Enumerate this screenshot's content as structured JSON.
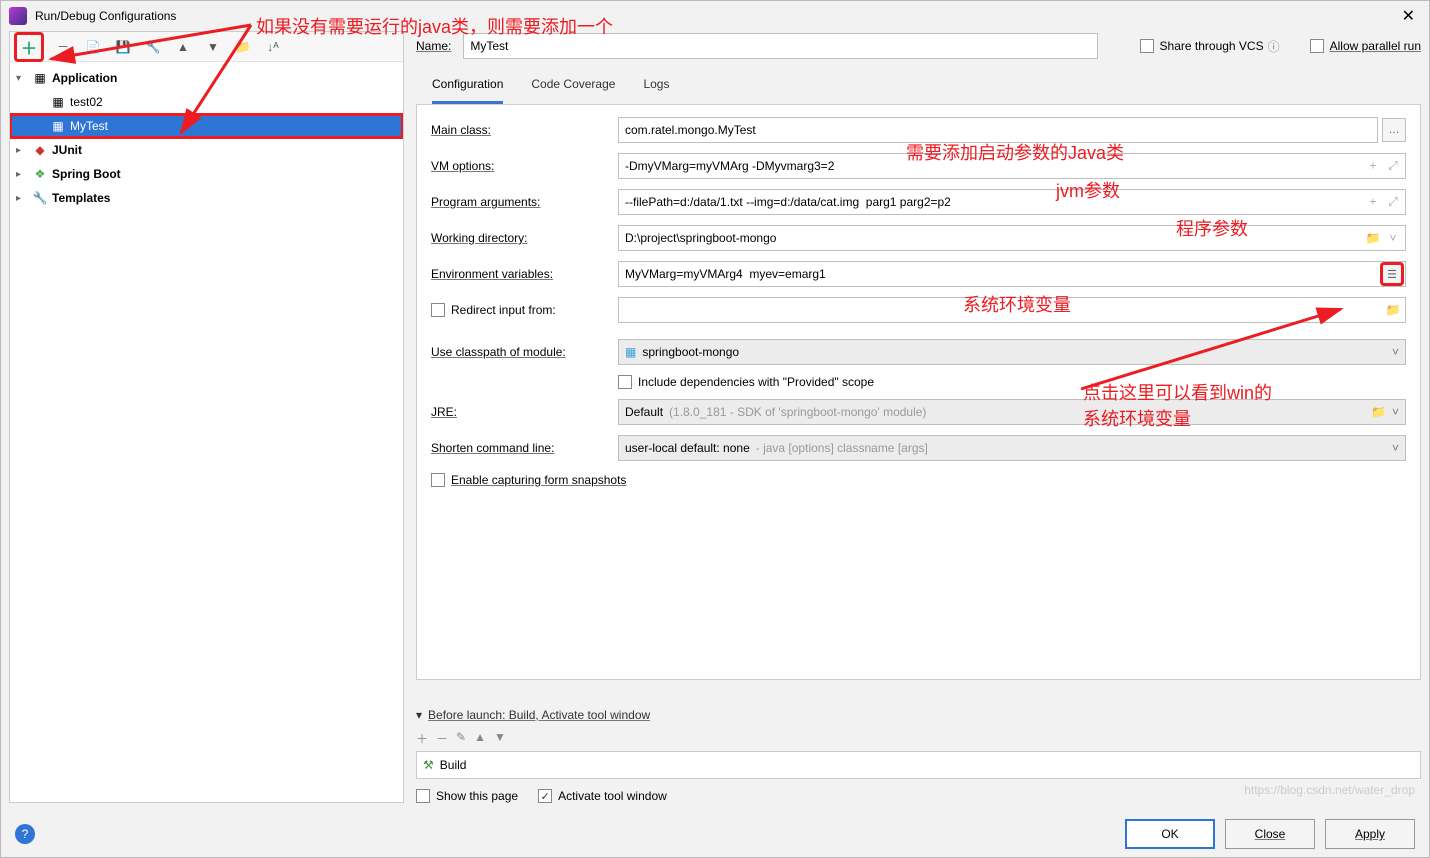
{
  "window": {
    "title": "Run/Debug Configurations"
  },
  "annotations": {
    "top": "如果没有需要运行的java类，则需要添加一个",
    "mainclass": "需要添加启动参数的Java类",
    "jvm": "jvm参数",
    "progargs": "程序参数",
    "envvar": "系统环境变量",
    "envbtn1": "点击这里可以看到win的",
    "envbtn2": "系统环境变量"
  },
  "tree": {
    "application": "Application",
    "items": [
      "test02",
      "MyTest"
    ],
    "junit": "JUnit",
    "springboot": "Spring Boot",
    "templates": "Templates"
  },
  "nameRow": {
    "label": "Name:",
    "value": "MyTest",
    "share": "Share through VCS",
    "parallel": "Allow parallel run"
  },
  "tabs": {
    "configuration": "Configuration",
    "coverage": "Code Coverage",
    "logs": "Logs"
  },
  "form": {
    "mainclass_label": "Main class:",
    "mainclass_value": "com.ratel.mongo.MyTest",
    "vmoptions_label": "VM options:",
    "vmoptions_value": "-DmyVMarg=myVMArg -DMyvmarg3=2",
    "progargs_label": "Program arguments:",
    "progargs_value": "--filePath=d:/data/1.txt --img=d:/data/cat.img  parg1 parg2=p2",
    "workdir_label": "Working directory:",
    "workdir_value": "D:\\project\\springboot-mongo",
    "envvar_label": "Environment variables:",
    "envvar_value": "MyVMarg=myVMArg4  myev=emarg1",
    "redirect_label": "Redirect input from:",
    "classpath_label": "Use classpath of module:",
    "classpath_value": "springboot-mongo",
    "include_label": "Include dependencies with \"Provided\" scope",
    "jre_label": "JRE:",
    "jre_value_pre": "Default ",
    "jre_value_gray": "(1.8.0_181 - SDK of 'springboot-mongo' module)",
    "shorten_label": "Shorten command line:",
    "shorten_value_pre": "user-local default: none ",
    "shorten_value_gray": "- java [options] classname [args]",
    "snapshot_label": "Enable capturing form snapshots"
  },
  "before": {
    "title": "Before launch: Build, Activate tool window",
    "build": "Build",
    "showpage": "Show this page",
    "activate": "Activate tool window"
  },
  "footer": {
    "ok": "OK",
    "cancel": "Close",
    "apply": "Apply"
  },
  "watermark": "https://blog.csdn.net/water_drop"
}
